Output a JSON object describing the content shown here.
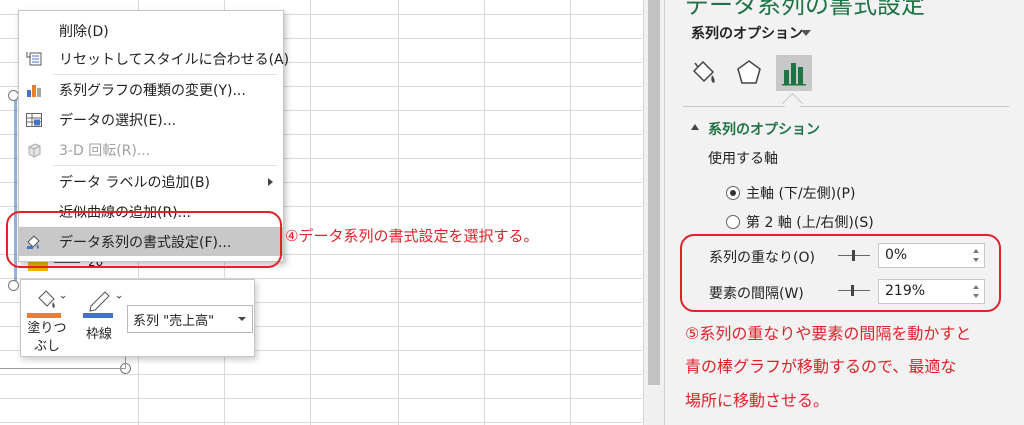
{
  "context_menu": {
    "items": [
      {
        "label": "削除(D)",
        "icon": "none",
        "enabled": true
      },
      {
        "label": "リセットしてスタイルに合わせる(A)",
        "icon": "reset-style-icon",
        "enabled": true
      },
      {
        "label": "系列グラフの種類の変更(Y)...",
        "icon": "change-chart-type-icon",
        "enabled": true
      },
      {
        "label": "データの選択(E)...",
        "icon": "select-data-icon",
        "enabled": true
      },
      {
        "label": "3-D 回転(R)...",
        "icon": "3d-rotation-icon",
        "enabled": false
      },
      {
        "label": "データ ラベルの追加(B)",
        "icon": "none",
        "enabled": true,
        "submenu": true
      },
      {
        "label": "近似曲線の追加(R)...",
        "icon": "none",
        "enabled": true
      },
      {
        "label": "データ系列の書式設定(F)...",
        "icon": "format-series-icon",
        "enabled": true,
        "highlighted": true
      }
    ]
  },
  "mini_toolbar": {
    "fill_label": "塗りつぶし",
    "fill_label_line1": "塗りつ",
    "fill_label_line2": "ぶし",
    "outline_label": "枠線",
    "series_select": "系列 \"売上高\"",
    "fill_color": "#ed7d31",
    "outline_color": "#4472c4"
  },
  "chart": {
    "axis_value": "20"
  },
  "annotations": {
    "step4": "④データ系列の書式設定を選択する。",
    "step5_line1": "⑤系列の重なりや要素の間隔を動かすと",
    "step5_line2": "青の棒グラフが移動するので、最適な",
    "step5_line3": "場所に移動させる。",
    "color": "#e0222a"
  },
  "format_pane": {
    "title": "データ系列の書式設定",
    "options_header": "系列のオプション",
    "tabs": [
      "fill-line-icon",
      "effects-pentagon-icon",
      "series-options-bar-chart-icon"
    ],
    "section_title": "系列のオプション",
    "axis_heading": "使用する軸",
    "primary_axis_label": "主軸 (下/左側)(P)",
    "secondary_axis_label": "第 2 軸 (上/右側)(S)",
    "primary_selected": true,
    "overlap_label": "系列の重なり(O)",
    "overlap_value": "0%",
    "overlap_percent": 0,
    "gap_label": "要素の間隔(W)",
    "gap_value": "219%",
    "gap_percent": 219,
    "accent_color": "#217346"
  }
}
